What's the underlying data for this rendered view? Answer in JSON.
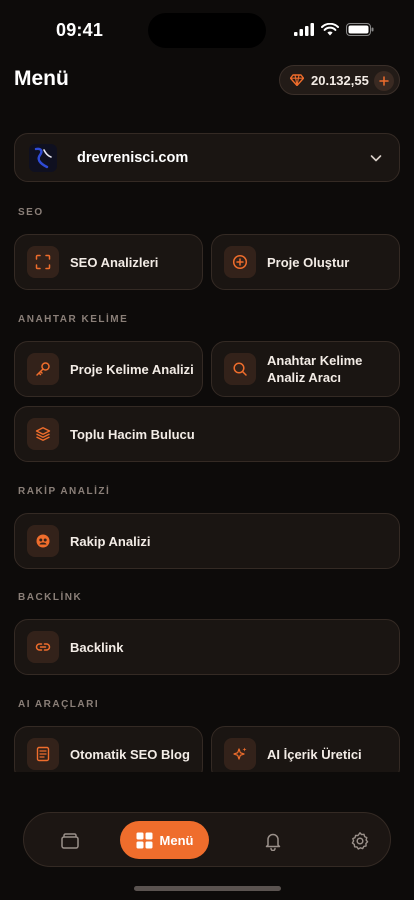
{
  "status_bar": {
    "time": "09:41"
  },
  "header": {
    "title": "Menü",
    "balance": "20.132,55"
  },
  "site": {
    "name": "drevrenisci.com"
  },
  "sections": {
    "seo": {
      "label": "SEO",
      "items": [
        {
          "label": "SEO Analizleri",
          "icon": "scan-icon"
        },
        {
          "label": "Proje Oluştur",
          "icon": "plus-circle-icon"
        }
      ]
    },
    "keyword": {
      "label": "ANAHTAR KELİME",
      "items": [
        {
          "label": "Proje Kelime Analizi",
          "icon": "key-icon"
        },
        {
          "label": "Anahtar Kelime Analiz Aracı",
          "icon": "search-icon"
        },
        {
          "label": "Toplu Hacim Bulucu",
          "icon": "layers-icon"
        }
      ]
    },
    "competitor": {
      "label": "RAKİP ANALİZİ",
      "items": [
        {
          "label": "Rakip Analizi",
          "icon": "competitor-icon"
        }
      ]
    },
    "backlink": {
      "label": "BACKLİNK",
      "items": [
        {
          "label": "Backlink",
          "icon": "link-icon"
        }
      ]
    },
    "ai": {
      "label": "AI ARAÇLARI",
      "items": [
        {
          "label": "Otomatik SEO Blog",
          "icon": "document-icon"
        },
        {
          "label": "AI İçerik Üretici",
          "icon": "sparkles-icon"
        }
      ]
    }
  },
  "tab_bar": {
    "active_label": "Menü",
    "tabs": [
      "wallet-icon",
      "grid-icon",
      "bell-icon",
      "settings-icon"
    ]
  },
  "colors": {
    "accent": "#ef6d2c",
    "background": "#0d0b0a",
    "card": "#1a1512"
  }
}
